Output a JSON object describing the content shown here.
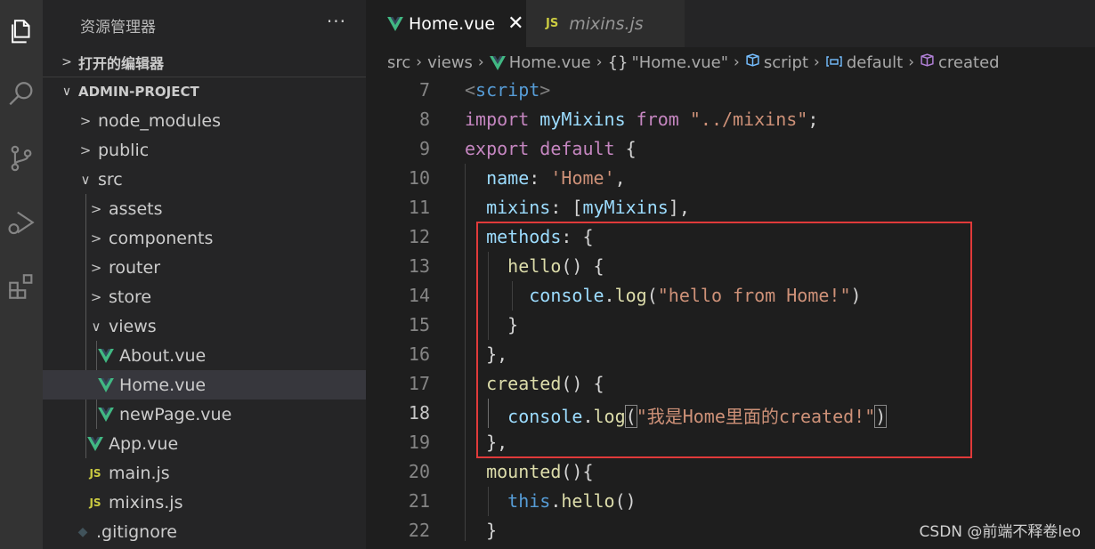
{
  "sidebar": {
    "title": "资源管理器",
    "more": "···",
    "open_editors": "打开的编辑器",
    "project": "ADMIN-PROJECT",
    "tree": {
      "node_modules": "node_modules",
      "public": "public",
      "src": "src",
      "assets": "assets",
      "components": "components",
      "router": "router",
      "store": "store",
      "views": "views",
      "about": "About.vue",
      "home": "Home.vue",
      "newpage": "newPage.vue",
      "app": "App.vue",
      "main": "main.js",
      "mixins": "mixins.js",
      "gitignore": ".gitignore"
    },
    "js_badge": "JS"
  },
  "tabs": [
    {
      "label": "Home.vue",
      "close": "✕"
    },
    {
      "label": "mixins.js"
    }
  ],
  "breadcrumb": [
    "src",
    "views",
    "Home.vue",
    "\"Home.vue\"",
    "script",
    "default",
    "created"
  ],
  "breadcrumb_icons": [
    "braces-icon",
    "script-icon",
    "default-icon",
    "created-icon"
  ],
  "breadcrumb_sep": "›",
  "breadcrumb_braces": "{}",
  "lines": [
    "7",
    "8",
    "9",
    "10",
    "11",
    "12",
    "13",
    "14",
    "15",
    "16",
    "17",
    "18",
    "19",
    "20",
    "21",
    "22"
  ],
  "code": {
    "l7_tag": "script",
    "l8_import": "import",
    "l8_name": "myMixins",
    "l8_from": "from",
    "l8_path": "\"../mixins\"",
    "l9_export": "export",
    "l9_default": "default",
    "l10_key": "name",
    "l10_val": "'Home'",
    "l11_key": "mixins",
    "l11_val": "myMixins",
    "l12_key": "methods",
    "l13_fn": "hello",
    "l14_obj": "console",
    "l14_fn": "log",
    "l14_str": "\"hello from Home!\"",
    "l17_fn": "created",
    "l18_obj": "console",
    "l18_fn": "log",
    "l18_str": "\"我是Home里面的created!\"",
    "l20_fn": "mounted",
    "l21_this": "this",
    "l21_fn": "hello"
  },
  "watermark": "CSDN @前端不释卷leo",
  "colors": {
    "highlight_box": "#e03a3a",
    "vue_green": "#41b883",
    "js_yellow": "#cbcb41"
  }
}
